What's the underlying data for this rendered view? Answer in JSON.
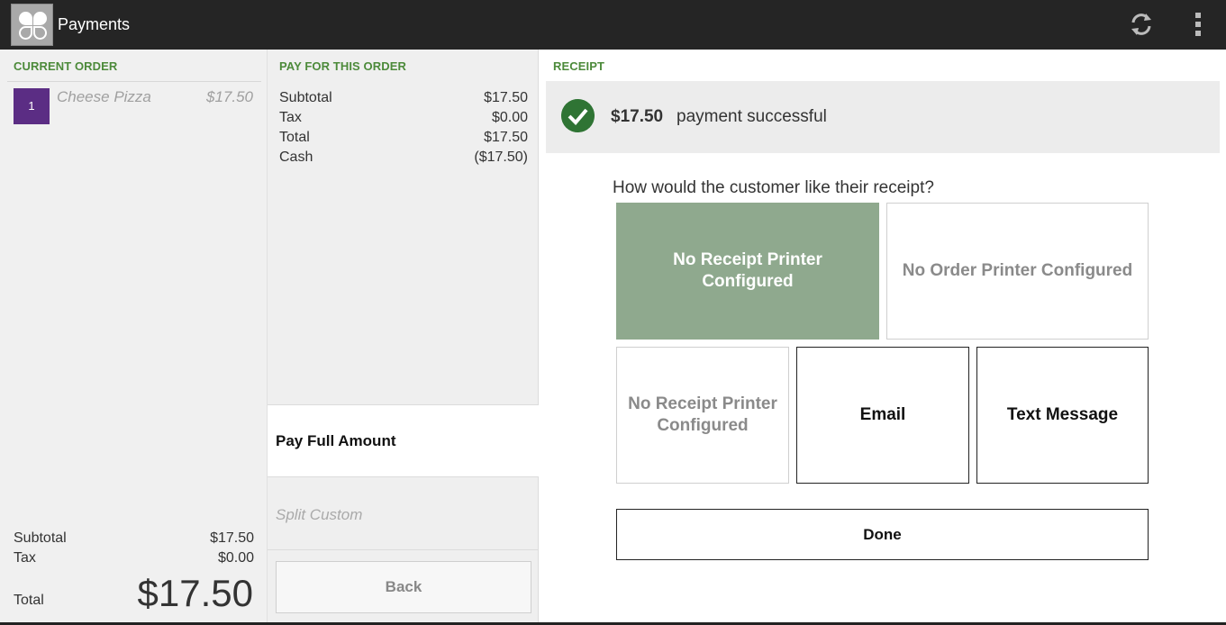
{
  "app": {
    "title": "Payments"
  },
  "order": {
    "header": "CURRENT ORDER",
    "items": [
      {
        "qty": "1",
        "name": "Cheese Pizza",
        "price": "$17.50"
      }
    ],
    "subtotal_label": "Subtotal",
    "subtotal_value": "$17.50",
    "tax_label": "Tax",
    "tax_value": "$0.00",
    "total_label": "Total",
    "total_value": "$17.50"
  },
  "pay": {
    "header": "PAY FOR THIS ORDER",
    "rows": [
      {
        "label": "Subtotal",
        "value": "$17.50"
      },
      {
        "label": "Tax",
        "value": "$0.00"
      },
      {
        "label": "Total",
        "value": "$17.50"
      },
      {
        "label": "Cash",
        "value": "($17.50)"
      }
    ],
    "pay_full_label": "Pay Full Amount",
    "split_custom_label": "Split Custom",
    "back_label": "Back"
  },
  "receipt": {
    "header": "RECEIPT",
    "success_amount": "$17.50",
    "success_text": "payment successful",
    "question": "How would the customer like their receipt?",
    "buttons": {
      "receipt_printer_top": "No Receipt Printer Configured",
      "order_printer": "No Order Printer Configured",
      "receipt_printer_bottom": "No Receipt Printer Configured",
      "email": "Email",
      "text_message": "Text Message"
    },
    "done_label": "Done"
  },
  "colors": {
    "accent_green": "#4c8a3a",
    "success_green": "#2f7434",
    "badge_purple": "#5b2d84",
    "button_green": "#8fa98e"
  }
}
